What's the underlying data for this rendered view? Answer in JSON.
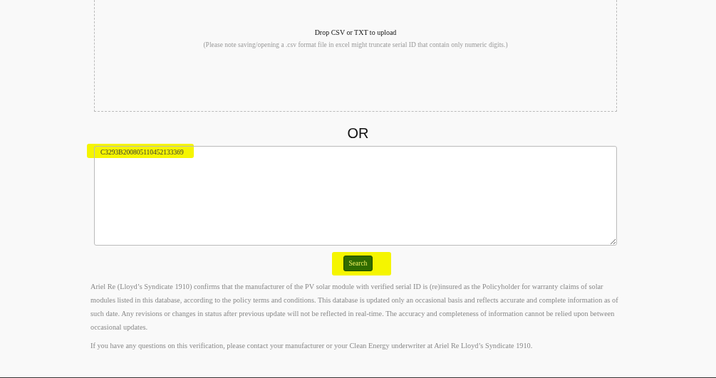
{
  "drop_zone": {
    "title": "Drop CSV or TXT to upload",
    "note": "(Please note saving/opening a .csv format file in excel might truncate serial ID that contain only numeric digits.)"
  },
  "separator": "OR",
  "serial_input": {
    "value": "C3293B200805110452133369"
  },
  "search_button": "Search",
  "disclaimer": [
    "Ariel Re (Lloyd’s Syndicate 1910) confirms that the manufacturer of the PV solar module with verified serial ID is (re)insured as the Policyholder for warranty claims of solar modules listed in this database, according to the policy terms and conditions. This database is updated only an occasional basis and reflects accurate and complete information as of such date. Any revisions or changes in status after previous update will not be reflected in real-time. The accuracy and completeness of information cannot be relied upon between occasional updates.",
    "If you have any questions on this verification, please contact your manufacturer or your Clean Energy underwriter at Ariel Re Lloyd’s Syndicate 1910."
  ]
}
